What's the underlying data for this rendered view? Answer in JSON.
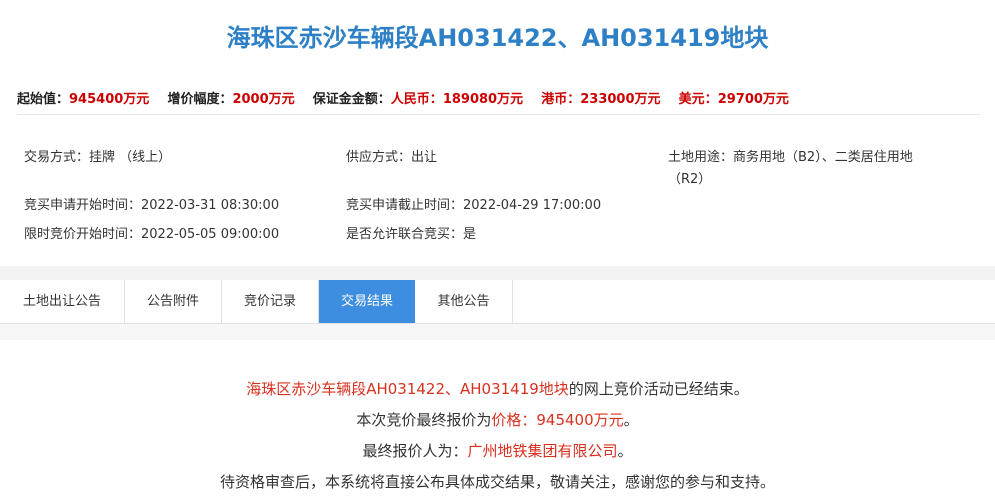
{
  "title": "海珠区赤沙车辆段AH031422、AH031419地块",
  "prices": {
    "start_label": "起始值：",
    "start_value": "945400万元",
    "step_label": "增价幅度：",
    "step_value": "2000万元",
    "deposit_label": "保证金金额：",
    "rmb_label": "人民币：",
    "rmb_value": "189080万元",
    "hkd_label": "港币：",
    "hkd_value": "233000万元",
    "usd_label": "美元：",
    "usd_value": "29700万元"
  },
  "info": {
    "trade_mode_label": "交易方式：",
    "trade_mode_value": "挂牌 （线上）",
    "supply_mode_label": "供应方式：",
    "supply_mode_value": "出让",
    "land_use_label": "土地用途：",
    "land_use_value_line1": "商务用地（B2）、二类居住用地",
    "land_use_value_line2": "（R2）",
    "apply_start_label": "竞买申请开始时间：",
    "apply_start_value": "2022-03-31 08:30:00",
    "apply_end_label": "竞买申请截止时间：",
    "apply_end_value": "2022-04-29 17:00:00",
    "bid_start_label": "限时竞价开始时间：",
    "bid_start_value": "2022-05-05 09:00:00",
    "joint_label": "是否允许联合竞买：",
    "joint_value": "是"
  },
  "tabs": [
    {
      "label": "土地出让公告"
    },
    {
      "label": "公告附件"
    },
    {
      "label": "竞价记录"
    },
    {
      "label": "交易结果"
    },
    {
      "label": "其他公告"
    }
  ],
  "result": {
    "line1_red": "海珠区赤沙车辆段AH031422、AH031419地块",
    "line1_rest": "的网上竞价活动已经结束。",
    "line2_prefix": "本次竞价最终报价为",
    "line2_red": "价格：945400万元",
    "line2_suffix": "。",
    "line3_prefix": "最终报价人为：",
    "line3_red": "广州地铁集团有限公司",
    "line3_suffix": "。",
    "line4": "待资格审查后，本系统将直接公布具体成交结果，敬请关注，感谢您的参与和支持。"
  },
  "colors": {
    "title": "#2e80c6",
    "price_red": "#cc0000",
    "tab_active": "#3d8ee0",
    "result_red": "#d9301f"
  }
}
